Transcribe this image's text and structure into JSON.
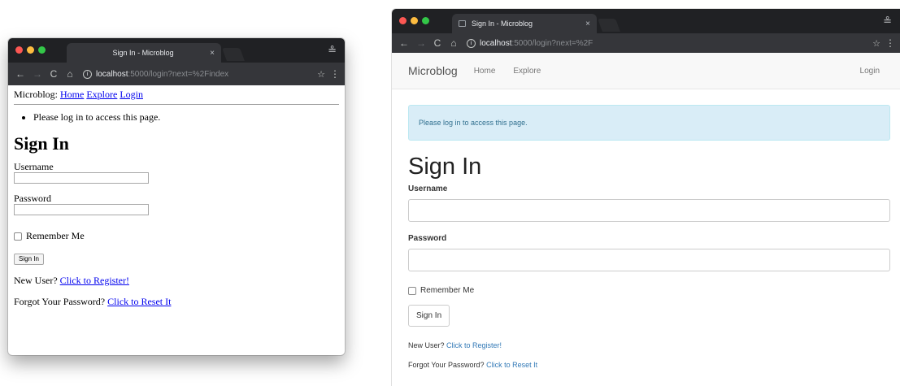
{
  "left_window": {
    "tab_title": "Sign In - Microblog",
    "tab_close": "×",
    "url_host": "localhost",
    "url_rest": ":5000/login?next=%2Findex",
    "brand_text": "Microblog:",
    "nav": [
      "Home",
      "Explore",
      "Login"
    ],
    "flash": "Please log in to access this page.",
    "heading": "Sign In",
    "username_label": "Username",
    "password_label": "Password",
    "remember_label": "Remember Me",
    "submit_label": "Sign In",
    "register_text": "New User?",
    "register_link": "Click to Register!",
    "reset_text": "Forgot Your Password?",
    "reset_link": "Click to Reset It"
  },
  "right_window": {
    "tab_title": "Sign In - Microblog",
    "tab_close": "×",
    "url_host": "localhost",
    "url_rest": ":5000/login?next=%2F",
    "brand": "Microblog",
    "nav": [
      "Home",
      "Explore"
    ],
    "nav_right": "Login",
    "flash": "Please log in to access this page.",
    "heading": "Sign In",
    "username_label": "Username",
    "password_label": "Password",
    "remember_label": "Remember Me",
    "submit_label": "Sign In",
    "register_text": "New User?",
    "register_link": "Click to Register!",
    "reset_text": "Forgot Your Password?",
    "reset_link": "Click to Reset It"
  },
  "chrome": {
    "back": "←",
    "forward": "→",
    "reload": "C",
    "home": "⌂",
    "info": "i",
    "star": "☆",
    "menu": "⋮",
    "incognito": "≗"
  }
}
